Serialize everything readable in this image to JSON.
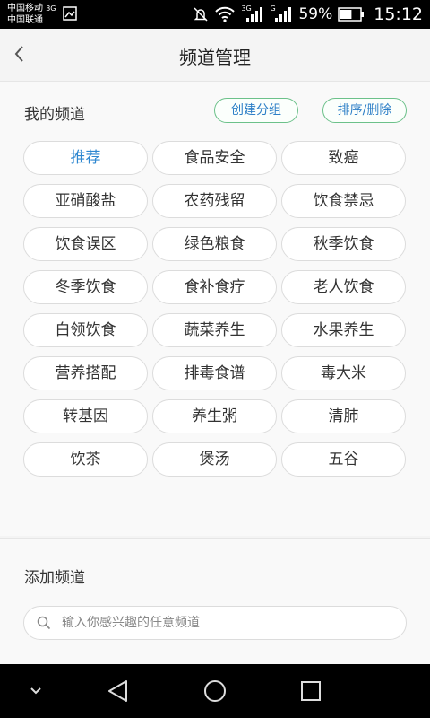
{
  "status_bar": {
    "carrier_1": "中国移动",
    "carrier_1_net": "3G",
    "carrier_2": "中国联通",
    "signal_1_label": "3G",
    "signal_2_label": "G",
    "battery": "59%",
    "battery_level": 0.59,
    "time": "15:12"
  },
  "header": {
    "title": "频道管理"
  },
  "my_channels": {
    "title": "我的频道",
    "create_group_label": "创建分组",
    "sort_delete_label": "排序/删除",
    "channels": [
      "推荐",
      "食品安全",
      "致癌",
      "亚硝酸盐",
      "农药残留",
      "饮食禁忌",
      "饮食误区",
      "绿色粮食",
      "秋季饮食",
      "冬季饮食",
      "食补食疗",
      "老人饮食",
      "白领饮食",
      "蔬菜养生",
      "水果养生",
      "营养搭配",
      "排毒食谱",
      "毒大米",
      "转基因",
      "养生粥",
      "清肺",
      "饮茶",
      "煲汤",
      "五谷"
    ],
    "active_index": 0
  },
  "add_channels": {
    "title": "添加频道",
    "search_placeholder": "输入你感兴趣的任意频道",
    "search_value": ""
  },
  "colors": {
    "accent_blue": "#2e87d0",
    "pill_border_green": "#6cc18a"
  }
}
